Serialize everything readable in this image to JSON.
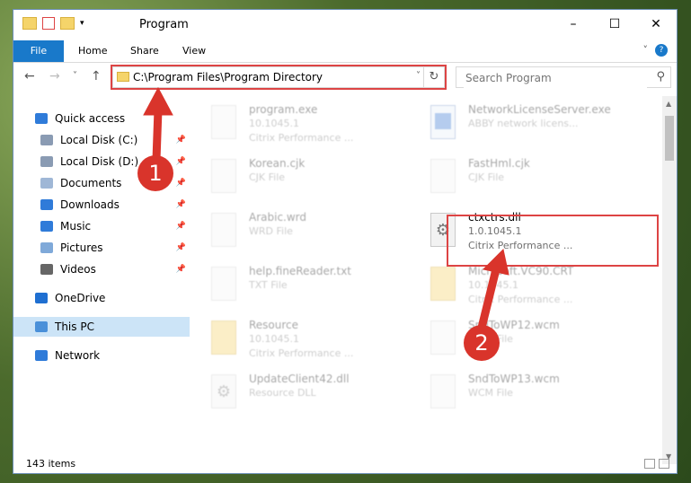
{
  "window": {
    "title": "Program",
    "minimize": "–",
    "maximize": "☐",
    "close": "✕"
  },
  "ribbon": {
    "tabs": [
      "File",
      "Home",
      "Share",
      "View"
    ]
  },
  "nav": {
    "back": "←",
    "forward": "→",
    "recent": "˅",
    "up": "↑",
    "address": "C:\\Program Files\\Program Directory",
    "search_placeholder": "Search Program"
  },
  "sidebar": {
    "items": [
      {
        "label": "Quick access",
        "icon": "star-icon",
        "pinned": false
      },
      {
        "label": "Local Disk (C:)",
        "icon": "drive-icon",
        "pinned": true
      },
      {
        "label": "Local Disk (D:)",
        "icon": "drive-icon",
        "pinned": true
      },
      {
        "label": "Documents",
        "icon": "documents-icon",
        "pinned": true
      },
      {
        "label": "Downloads",
        "icon": "download-icon",
        "pinned": true
      },
      {
        "label": "Music",
        "icon": "music-icon",
        "pinned": true
      },
      {
        "label": "Pictures",
        "icon": "pictures-icon",
        "pinned": true
      },
      {
        "label": "Videos",
        "icon": "videos-icon",
        "pinned": true
      },
      {
        "label": "OneDrive",
        "icon": "cloud-icon",
        "pinned": false
      },
      {
        "label": "This PC",
        "icon": "computer-icon",
        "pinned": false,
        "selected": true
      },
      {
        "label": "Network",
        "icon": "network-icon",
        "pinned": false
      }
    ]
  },
  "files": [
    {
      "name": "program.exe",
      "line2": "10.1045.1",
      "line3": "Citrix Performance ...",
      "type": "exe"
    },
    {
      "name": "NetworkLicenseServer.exe",
      "line2": "ABBY network licens...",
      "line3": "",
      "type": "blue"
    },
    {
      "name": "Korean.cjk",
      "line2": "CJK File",
      "line3": "",
      "type": "doc"
    },
    {
      "name": "FastHml.cjk",
      "line2": "CJK File",
      "line3": "",
      "type": "doc"
    },
    {
      "name": "Arabic.wrd",
      "line2": "WRD File",
      "line3": "",
      "type": "doc"
    },
    {
      "name": "ctxctrs.dll",
      "line2": "1.0.1045.1",
      "line3": "Citrix Performance ...",
      "type": "gear"
    },
    {
      "name": "help.fineReader.txt",
      "line2": "TXT File",
      "line3": "",
      "type": "doc"
    },
    {
      "name": "Microsoft.VC90.CRT",
      "line2": "10.1045.1",
      "line3": "Citrix Performance ...",
      "type": "folder"
    },
    {
      "name": "Resource",
      "line2": "10.1045.1",
      "line3": "Citrix Performance ...",
      "type": "folder"
    },
    {
      "name": "SndToWP12.wcm",
      "line2": "WCM File",
      "line3": "",
      "type": "doc"
    },
    {
      "name": "UpdateClient42.dll",
      "line2": "Resource DLL",
      "line3": "",
      "type": "gear"
    },
    {
      "name": "SndToWP13.wcm",
      "line2": "WCM File",
      "line3": "",
      "type": "doc"
    }
  ],
  "status": {
    "count": "143 items"
  },
  "annotations": {
    "badge1": "1",
    "badge2": "2",
    "color": "#d9342b"
  }
}
